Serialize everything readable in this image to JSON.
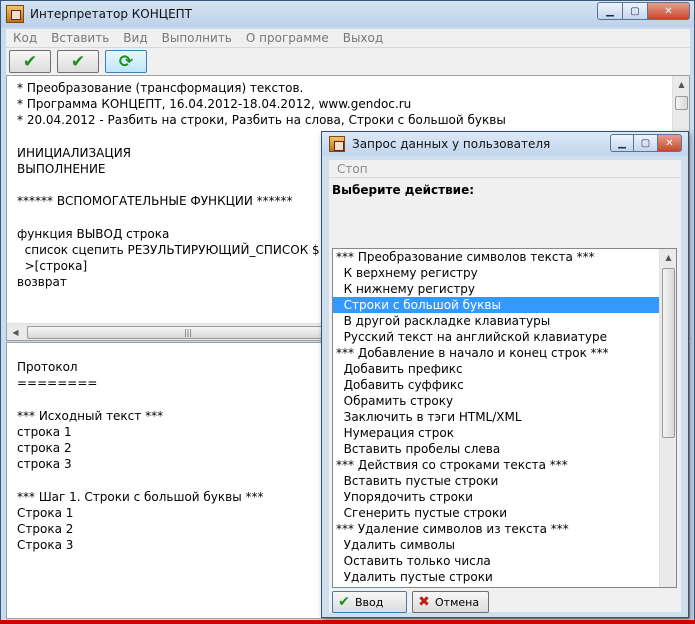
{
  "main_window": {
    "title": "Интерпретатор КОНЦЕПТ",
    "menu": [
      "Код",
      "Вставить",
      "Вид",
      "Выполнить",
      "О программе",
      "Выход"
    ],
    "toolbar": {
      "btn1_icon": "checkmark-icon",
      "btn2_icon": "checkmark-icon",
      "btn3_icon": "refresh-icon"
    },
    "editor_text": "* Преобразование (трансформация) текстов.\n* Программа КОНЦЕПТ, 16.04.2012-18.04.2012, www.gendoc.ru\n* 20.04.2012 - Разбить на строки, Разбить на слова, Строки с большой буквы\n\nИНИЦИАЛИЗАЦИЯ\nВЫПОЛНЕНИЕ\n\n****** ВСПОМОГАТЕЛЬНЫЕ ФУНКЦИИ ******\n\nфункция ВЫВОД строка\n  список сцепить РЕЗУЛЬТИРУЮЩИЙ_СПИСОК $ (стр\n  >[строка]\nвозврат",
    "protocol_text": "Протокол\n========\n\n*** Исходный текст ***\nстрока 1\nстрока 2\nстрока 3\n\n*** Шаг 1. Строки с большой буквы ***\nСтрока 1\nСтрока 2\nСтрока 3"
  },
  "dialog": {
    "title": "Запрос данных у пользователя",
    "menu_item": "Стоп",
    "prompt": "Выберите действие:",
    "selected_index": 3,
    "items": [
      "*** Преобразование символов текста ***",
      "  К верхнему регистру",
      "  К нижнему регистру",
      "  Строки с большой буквы",
      "  В другой раскладке клавиатуры",
      "  Русский текст на английской клавиатуре",
      "*** Добавление в начало и конец строк ***",
      "  Добавить префикс",
      "  Добавить суффикс",
      "  Обрамить строку",
      "  Заключить в тэги HTML/XML",
      "  Нумерация строк",
      "  Вставить пробелы слева",
      "*** Действия со строками текста ***",
      "  Вставить пустые строки",
      "  Упорядочить строки",
      "  Сгенерить пустые строки",
      "*** Удаление символов из текста ***",
      "  Удалить символы",
      "  Оставить только числа",
      "  Удалить пустые строки"
    ],
    "ok_label": "Ввод",
    "cancel_label": "Отмена"
  },
  "colors": {
    "selection": "#3399ff",
    "accent_red": "#d00000",
    "ok_green": "#1e8f1e"
  }
}
